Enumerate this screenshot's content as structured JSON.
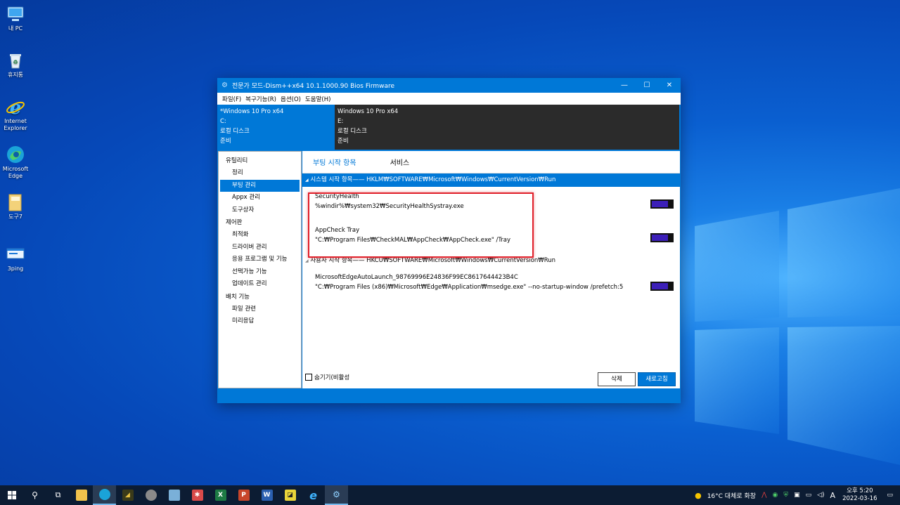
{
  "desktop": {
    "icons": [
      {
        "label": "내 PC"
      },
      {
        "label": "휴지통"
      },
      {
        "label": "Internet Explorer"
      },
      {
        "label": "Microsoft Edge"
      },
      {
        "label": "도구7"
      },
      {
        "label": "3ping"
      }
    ]
  },
  "window": {
    "title": "전문가 모드-Dism++x64 10.1.1000.90 Bios Firmware",
    "controls": {
      "minimize": "—",
      "maximize": "☐",
      "close": "✕"
    },
    "menu": [
      "파일(F)",
      "복구기능(R)",
      "옵션(O)",
      "도움말(H)"
    ],
    "systems": [
      {
        "name": "*Windows 10 Pro x64",
        "drive": "C:",
        "type": "로컬 디스크",
        "status": "준비"
      },
      {
        "name": "Windows 10 Pro x64",
        "drive": "E:",
        "type": "로컬 디스크",
        "status": "준비"
      }
    ],
    "sidebar": {
      "groups": [
        {
          "label": "유틸리티",
          "items": [
            "정리",
            "부팅 관리",
            "Appx 관리",
            "도구상자"
          ]
        },
        {
          "label": "제어판",
          "items": [
            "최적화",
            "드라이버 관리",
            "응용 프로그램 및 기능",
            "선택가능 기능",
            "업데이트 관리"
          ]
        },
        {
          "label": "배치 기능",
          "items": [
            "파일 관련",
            "미리응답"
          ]
        }
      ],
      "active_item": "부팅 관리"
    },
    "tabs": [
      "부팅 시작 항목",
      "서비스"
    ],
    "sections": [
      {
        "header": "시스템 시작 항목—— HKLM₩SOFTWARE₩Microsoft₩Windows₩CurrentVersion₩Run",
        "entries": [
          {
            "name": "SecurityHealth",
            "command": "%windir%₩system32₩SecurityHealthSystray.exe",
            "enabled": true
          },
          {
            "name": "AppCheck Tray",
            "command": "\"C:₩Program Files₩CheckMAL₩AppCheck₩AppCheck.exe\" /Tray",
            "enabled": true
          }
        ]
      },
      {
        "header": "사용자 시작 항목—— HKCU₩SOFTWARE₩Microsoft₩Windows₩CurrentVersion₩Run",
        "entries": [
          {
            "name": "MicrosoftEdgeAutoLaunch_98769996E24836F99EC8617644423B4C",
            "command": "\"C:₩Program Files (x86)₩Microsoft₩Edge₩Application₩msedge.exe\" --no-startup-window /prefetch:5",
            "enabled": true
          }
        ]
      }
    ],
    "hide_disabled_label": "숨기기(비활성",
    "delete_label": "삭제",
    "refresh_label": "새로고침"
  },
  "taskbar": {
    "weather": "16°C 대체로 화창",
    "ime": "A",
    "time": "오후 5:20",
    "date": "2022-03-16"
  },
  "colors": {
    "accent": "#0078d7",
    "toggle_on": "#3c1fb8",
    "highlight": "#e0202a",
    "taskbar": "#0c1c33"
  }
}
